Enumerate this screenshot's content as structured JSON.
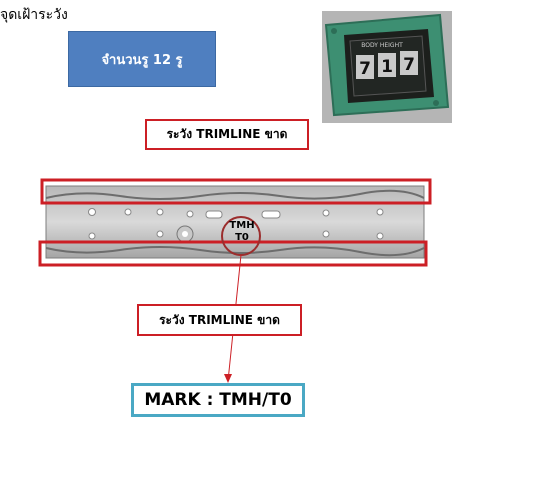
{
  "title": "จุดเฝ้าระวัง",
  "hole_count_label": "จำนวนรู 12 รู",
  "callout_top": "ระวัง TRIMLINE ขาด",
  "callout_bottom": "ระวัง TRIMLINE ขาด",
  "part_mark_line1": "TMH",
  "part_mark_line2": "T0",
  "mark_label": "MARK : TMH/T0",
  "photo": {
    "digits": [
      "7",
      "1",
      "7"
    ],
    "top_text": "BODY HEIGHT"
  },
  "colors": {
    "highlight": "#cc1f25",
    "blue_box": "#4f7fc0",
    "mark_border": "#4aa8c4"
  }
}
